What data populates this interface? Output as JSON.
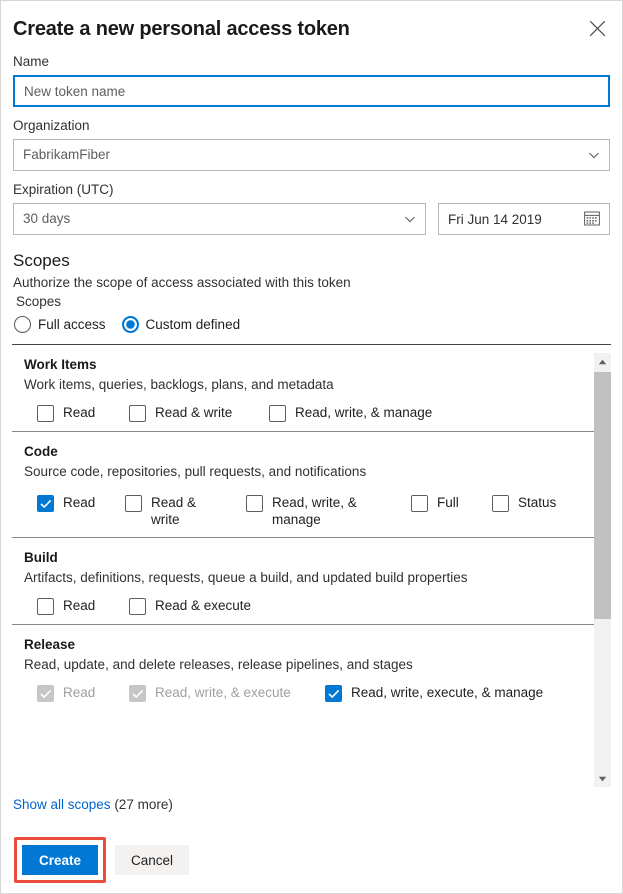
{
  "dialog": {
    "title": "Create a new personal access token",
    "close_icon": "close-icon"
  },
  "form": {
    "name": {
      "label": "Name",
      "value": "New token name",
      "placeholder": "New token name"
    },
    "organization": {
      "label": "Organization",
      "value": "FabrikamFiber",
      "chevron_icon": "chevron-down-icon"
    },
    "expiration": {
      "label": "Expiration (UTC)",
      "value": "30 days",
      "chevron_icon": "chevron-down-icon",
      "date_value": "Fri Jun 14 2019",
      "calendar_icon": "calendar-icon"
    }
  },
  "scopes": {
    "title": "Scopes",
    "subtitle": "Authorize the scope of access associated with this token",
    "legend": "Scopes",
    "radios": [
      {
        "label": "Full access",
        "checked": false
      },
      {
        "label": "Custom defined",
        "checked": true
      }
    ],
    "groups": [
      {
        "name": "Work Items",
        "description": "Work items, queries, backlogs, plans, and metadata",
        "options": [
          {
            "label": "Read",
            "checked": false,
            "disabled": false,
            "wrap": false
          },
          {
            "label": "Read & write",
            "checked": false,
            "disabled": false,
            "wrap": false
          },
          {
            "label": "Read, write, & manage",
            "checked": false,
            "disabled": false,
            "wrap": false
          }
        ]
      },
      {
        "name": "Code",
        "description": "Source code, repositories, pull requests, and notifications",
        "options": [
          {
            "label": "Read",
            "checked": true,
            "disabled": false,
            "wrap": false
          },
          {
            "label": "Read & write",
            "checked": false,
            "disabled": false,
            "wrap": true
          },
          {
            "label": "Read, write, & manage",
            "checked": false,
            "disabled": false,
            "wrap": true
          },
          {
            "label": "Full",
            "checked": false,
            "disabled": false,
            "wrap": false
          },
          {
            "label": "Status",
            "checked": false,
            "disabled": false,
            "wrap": false
          }
        ]
      },
      {
        "name": "Build",
        "description": "Artifacts, definitions, requests, queue a build, and updated build properties",
        "options": [
          {
            "label": "Read",
            "checked": false,
            "disabled": false,
            "wrap": false
          },
          {
            "label": "Read & execute",
            "checked": false,
            "disabled": false,
            "wrap": false
          }
        ]
      },
      {
        "name": "Release",
        "description": "Read, update, and delete releases, release pipelines, and stages",
        "options": [
          {
            "label": "Read",
            "checked": true,
            "disabled": true,
            "wrap": false
          },
          {
            "label": "Read, write, & execute",
            "checked": true,
            "disabled": true,
            "wrap": false
          },
          {
            "label": "Read, write, execute, & manage",
            "checked": true,
            "disabled": false,
            "wrap": false
          }
        ]
      }
    ],
    "scrollbar": {
      "up_icon": "scroll-up-arrow-icon",
      "down_icon": "scroll-down-arrow-icon"
    }
  },
  "footer": {
    "show_all_link": "Show all scopes",
    "show_all_count": " (27 more)",
    "create_label": "Create",
    "cancel_label": "Cancel"
  },
  "colors": {
    "accent": "#0078d4",
    "link": "#0066cc",
    "highlight": "#e74c3c",
    "disabled": "#c8c6c4"
  }
}
